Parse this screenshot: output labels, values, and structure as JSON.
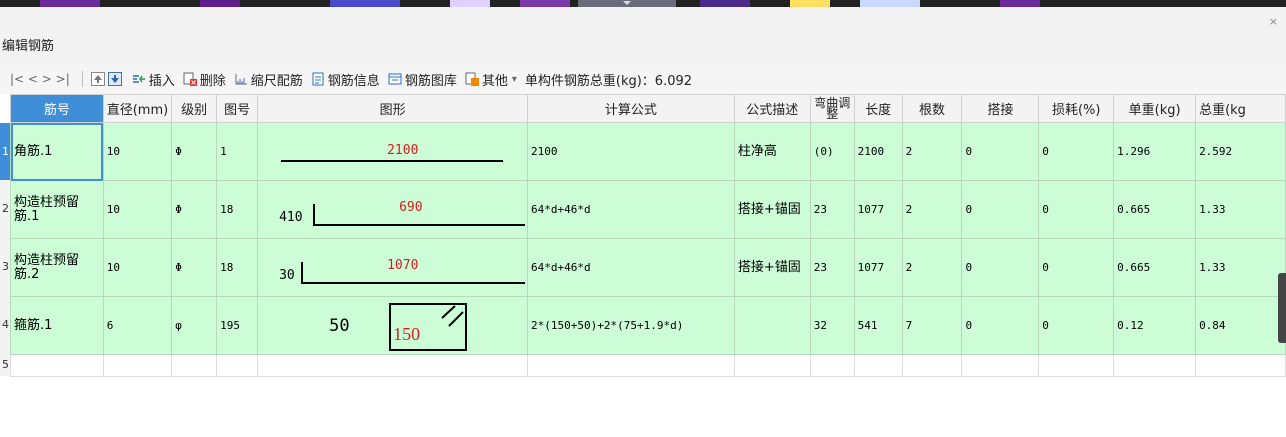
{
  "window": {
    "title": "编辑钢筋",
    "close_glyph": "×"
  },
  "toolbar": {
    "nav": "|<  <  >  >|",
    "insert": "插入",
    "delete": "删除",
    "scale": "缩尺配筋",
    "info": "钢筋信息",
    "library": "钢筋图库",
    "other": "其他",
    "other_caret": "▾",
    "total_label": "单构件钢筋总重(kg)：6.092"
  },
  "columns": [
    "筋号",
    "直径(mm)",
    "级别",
    "图号",
    "图形",
    "计算公式",
    "公式描述",
    "弯曲调整",
    "长度",
    "根数",
    "搭接",
    "损耗(%)",
    "单重(kg)",
    "总重(kg"
  ],
  "rows": [
    {
      "num": "1",
      "name": "角筋.1",
      "dia": "10",
      "grade": "Φ",
      "fig": "1",
      "shape": {
        "top": "2100"
      },
      "formula": "2100",
      "desc": "柱净高",
      "bend": "(0)",
      "length": "2100",
      "count": "2",
      "lap": "0",
      "loss": "0",
      "unit": "1.296",
      "total": "2.592"
    },
    {
      "num": "2",
      "name": "构造柱预留筋.1",
      "dia": "10",
      "grade": "Φ",
      "fig": "18",
      "shape": {
        "left": "410",
        "top": "690"
      },
      "formula": "64*d+46*d",
      "desc": "搭接+锚固",
      "bend": "23",
      "length": "1077",
      "count": "2",
      "lap": "0",
      "loss": "0",
      "unit": "0.665",
      "total": "1.33"
    },
    {
      "num": "3",
      "name": "构造柱预留筋.2",
      "dia": "10",
      "grade": "Φ",
      "fig": "18",
      "shape": {
        "left": "30",
        "top": "1070"
      },
      "formula": "64*d+46*d",
      "desc": "搭接+锚固",
      "bend": "23",
      "length": "1077",
      "count": "2",
      "lap": "0",
      "loss": "0",
      "unit": "0.665",
      "total": "1.33"
    },
    {
      "num": "4",
      "name": "箍筋.1",
      "dia": "6",
      "grade": "φ",
      "fig": "195",
      "shape": {
        "left": "50",
        "box": "150"
      },
      "formula": "2*(150+50)+2*(75+1.9*d)",
      "desc": "",
      "bend": "32",
      "length": "541",
      "count": "7",
      "lap": "0",
      "loss": "0",
      "unit": "0.12",
      "total": "0.84"
    }
  ],
  "empty_row_num": "5",
  "colors": {
    "row_bg": "#ccfdd6",
    "header_active": "#3e8ed8",
    "shape_text": "#d22020"
  }
}
